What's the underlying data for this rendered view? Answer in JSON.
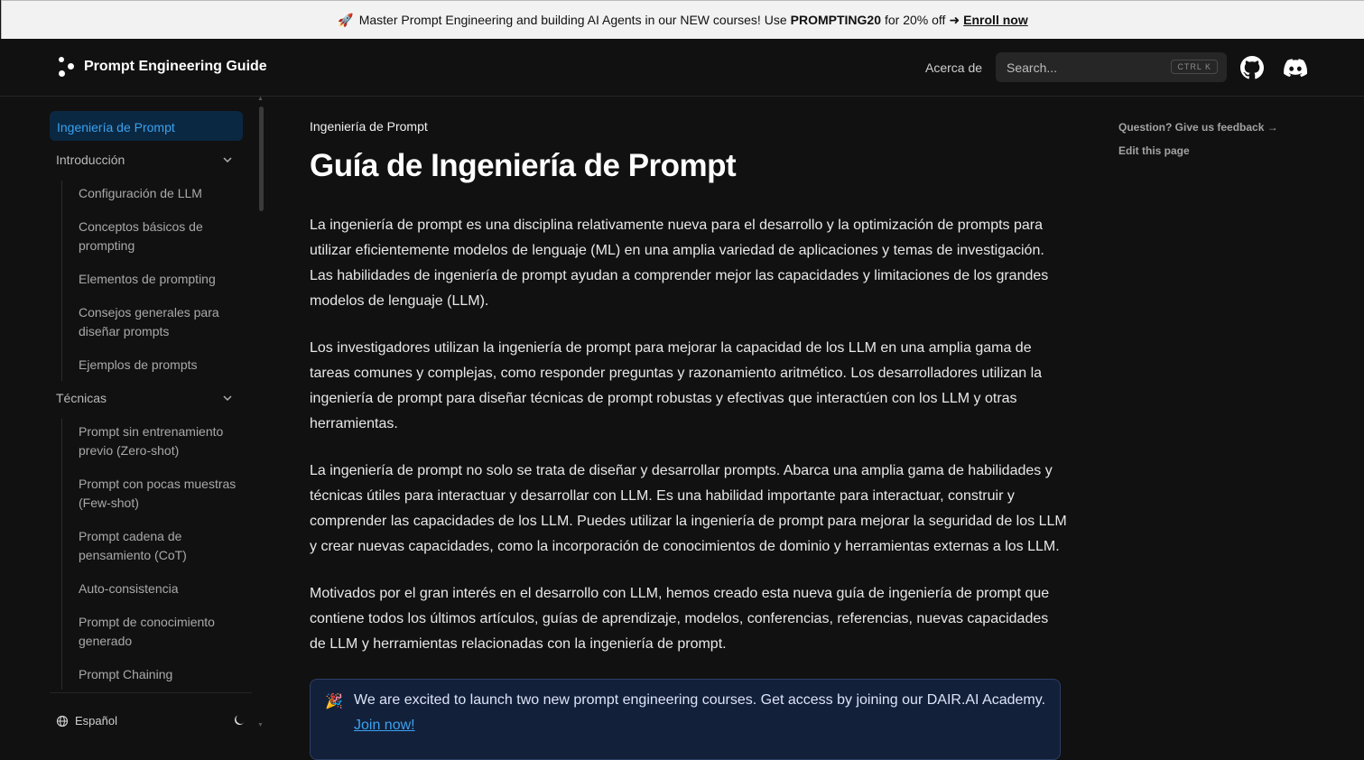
{
  "banner": {
    "icon": "rocket-icon",
    "text": "Master Prompt Engineering and building AI Agents in our NEW courses! Use",
    "code": "PROMPTING20",
    "suffix": "for 20% off",
    "arrow": "➜",
    "link": "Enroll now"
  },
  "header": {
    "logo_text": "Prompt Engineering Guide",
    "about": "Acerca de",
    "search_placeholder": "Search...",
    "search_kbd": "CTRL K"
  },
  "sidebar": {
    "active": "Ingeniería de Prompt",
    "sections": [
      {
        "label": "Introducción",
        "items": [
          "Configuración de LLM",
          "Conceptos básicos de prompting",
          "Elementos de prompting",
          "Consejos generales para diseñar prompts",
          "Ejemplos de prompts"
        ]
      },
      {
        "label": "Técnicas",
        "items": [
          "Prompt sin entrenamiento previo (Zero-shot)",
          "Prompt con pocas muestras (Few-shot)",
          "Prompt cadena de pensamiento (CoT)",
          "Auto-consistencia",
          "Prompt de conocimiento generado",
          "Prompt Chaining"
        ]
      }
    ],
    "language": "Español"
  },
  "main": {
    "breadcrumb": "Ingeniería de Prompt",
    "title": "Guía de Ingeniería de Prompt",
    "paragraphs": [
      "La ingeniería de prompt es una disciplina relativamente nueva para el desarrollo y la optimización de prompts para utilizar eficientemente modelos de lenguaje (ML) en una amplia variedad de aplicaciones y temas de investigación. Las habilidades de ingeniería de prompt ayudan a comprender mejor las capacidades y limitaciones de los grandes modelos de lenguaje (LLM).",
      "Los investigadores utilizan la ingeniería de prompt para mejorar la capacidad de los LLM en una amplia gama de tareas comunes y complejas, como responder preguntas y razonamiento aritmético. Los desarrolladores utilizan la ingeniería de prompt para diseñar técnicas de prompt robustas y efectivas que interactúen con los LLM y otras herramientas.",
      "La ingeniería de prompt no solo se trata de diseñar y desarrollar prompts. Abarca una amplia gama de habilidades y técnicas útiles para interactuar y desarrollar con LLM. Es una habilidad importante para interactuar, construir y comprender las capacidades de los LLM. Puedes utilizar la ingeniería de prompt para mejorar la seguridad de los LLM y crear nuevas capacidades, como la incorporación de conocimientos de dominio y herramientas externas a los LLM.",
      "Motivados por el gran interés en el desarrollo con LLM, hemos creado esta nueva guía de ingeniería de prompt que contiene todos los últimos artículos, guías de aprendizaje, modelos, conferencias, referencias, nuevas capacidades de LLM y herramientas relacionadas con la ingeniería de prompt."
    ],
    "callout_icon": "party-popper-icon",
    "callout_text": "We are excited to launch two new prompt engineering courses. Get access by joining our DAIR.AI Academy.",
    "callout_link": "Join now!"
  },
  "toc": {
    "feedback": "Question? Give us feedback →",
    "edit": "Edit this page"
  }
}
